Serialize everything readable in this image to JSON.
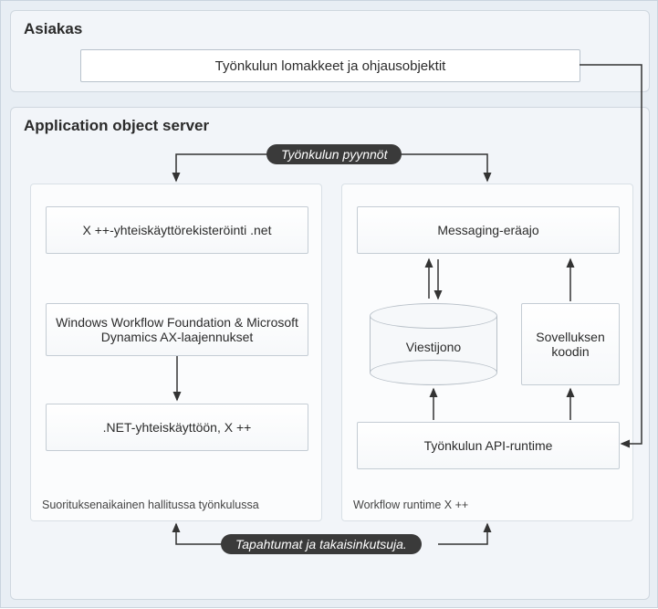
{
  "client": {
    "title": "Asiakas",
    "forms": "Työnkulun lomakkeet ja ohjausobjektit"
  },
  "aos": {
    "title": "Application object server",
    "requests_label": "Työnkulun pyynnöt",
    "events_label": "Tapahtumat ja takaisinkutsuja.",
    "left": {
      "interop_register": "X ++-yhteiskäyttörekisteröinti .net",
      "wf_ext": "Windows Workflow Foundation & Microsoft Dynamics AX-laajennukset",
      "net_interop": ".NET-yhteiskäyttöön, X ++",
      "caption": "Suorituksenaikainen hallitussa työnkulussa"
    },
    "right": {
      "messaging": "Messaging-eräajo",
      "msg_queue": "Viestijono",
      "app_code": "Sovelluksen koodin",
      "api_runtime": "Työnkulun API-runtime",
      "caption": "Workflow runtime X ++"
    }
  }
}
